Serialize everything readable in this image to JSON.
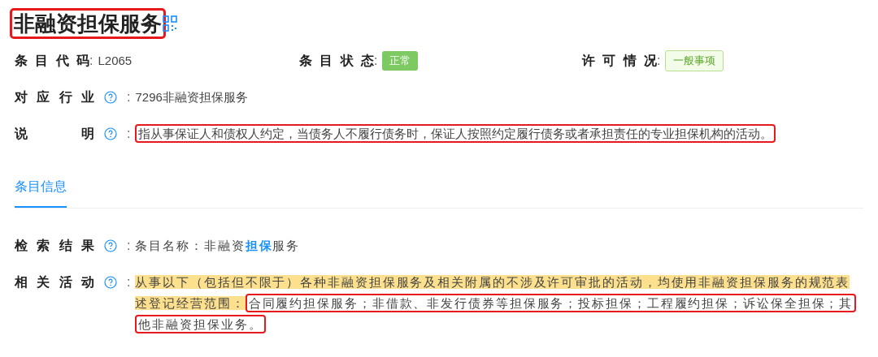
{
  "title": {
    "text": "非融资担保服务",
    "annotated": true
  },
  "summary": [
    {
      "label": "条目代码",
      "colon": ":",
      "kind": "text",
      "value": "L2065"
    },
    {
      "label": "条目状态",
      "colon": ":",
      "kind": "solid-tag",
      "value": "正常"
    },
    {
      "label": "许可情况",
      "colon": ":",
      "kind": "outline-tag",
      "value": "一般事项"
    }
  ],
  "details": [
    {
      "label": "对应行业",
      "colon": ":",
      "segments": [
        {
          "text": "7296非融资担保服务",
          "highlighted": false,
          "annotated": false
        }
      ]
    },
    {
      "label": "说明",
      "colon": ":",
      "segments": [
        {
          "text": "指从事保证人和债权人约定，当债务人不履行债务时，保证人按照约定履行债务或者承担责任的专业担保机构的活动。",
          "highlighted": false,
          "annotated": true
        }
      ]
    }
  ],
  "tabs": [
    {
      "label": "条目信息",
      "selected": true
    }
  ],
  "info": [
    {
      "label": "检索结果",
      "colon": ":",
      "segments": [
        {
          "text": "条目名称：非融资**担保**服务",
          "highlighted": false,
          "annotated": false
        }
      ]
    },
    {
      "label": "相关活动",
      "colon": ":",
      "segments": [
        {
          "text": "从事以下（包括但不限于）各种非融资担保服务及相关附属的不涉及许可审批的活动，均使用非融资担保服务的规范表述登记经营范围：",
          "highlighted": true,
          "annotated": false
        },
        {
          "text": "合同履约担保服务；非借款、非发行债券等担保服务；投标担保；工程履约担保；诉讼保全担保；其他非融资担保业务。",
          "highlighted": false,
          "annotated": true
        }
      ]
    }
  ]
}
